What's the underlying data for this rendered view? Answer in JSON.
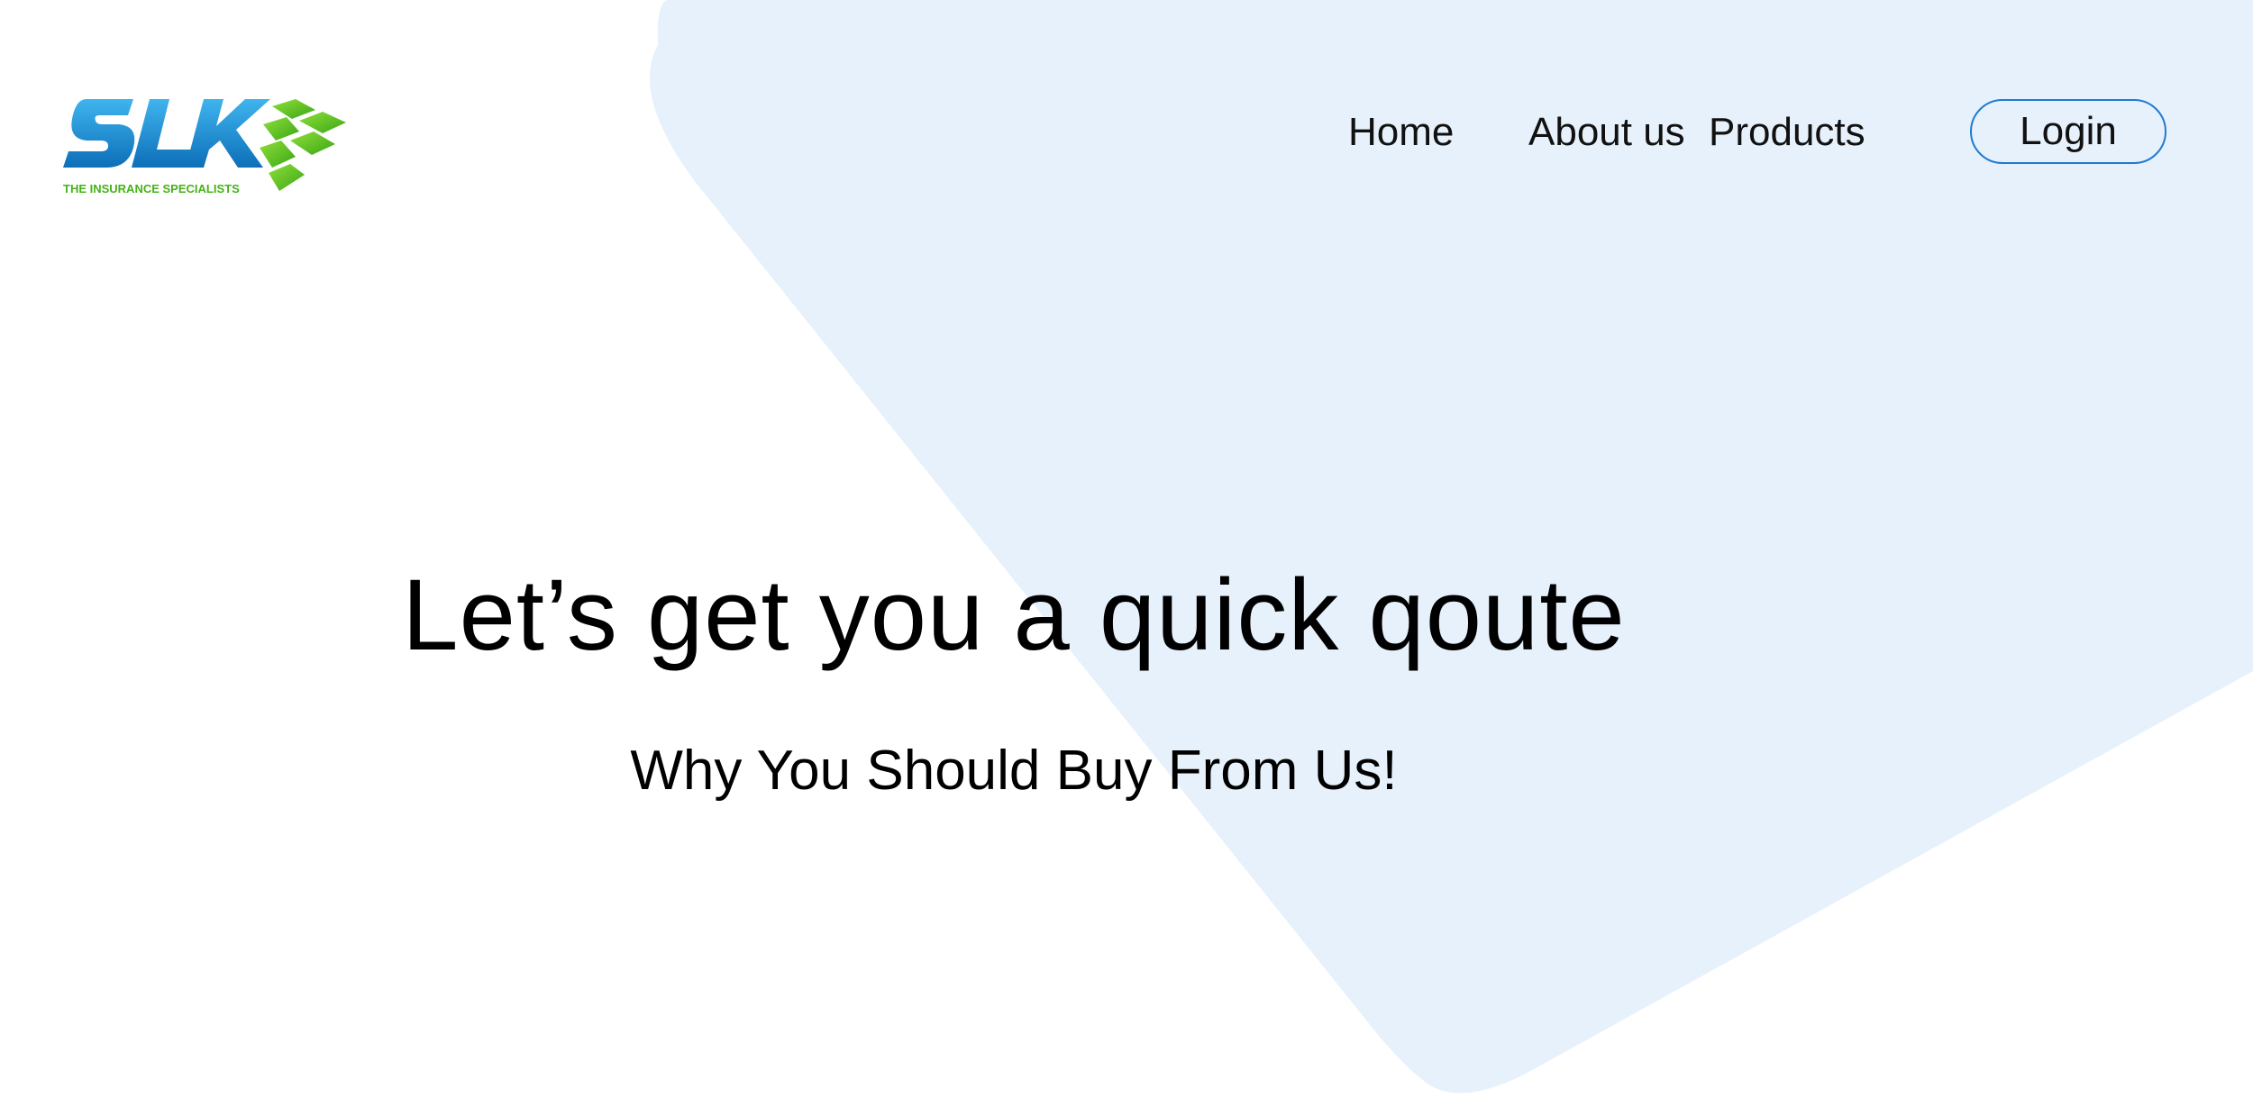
{
  "logo": {
    "brand": "SLK",
    "tagline": "THE INSURANCE SPECIALISTS",
    "primary_color": "#1a8fd6",
    "accent_color": "#5bbd1f"
  },
  "nav": {
    "home_label": "Home",
    "about_label": "About us",
    "products_label": "Products",
    "login_label": "Login"
  },
  "hero": {
    "title": "Let’s get you a quick qoute",
    "subtitle": "Why You Should Buy From Us!"
  },
  "colors": {
    "background_shape": "#e7f1fb",
    "login_border": "#1f7ad1",
    "text": "#111111"
  }
}
